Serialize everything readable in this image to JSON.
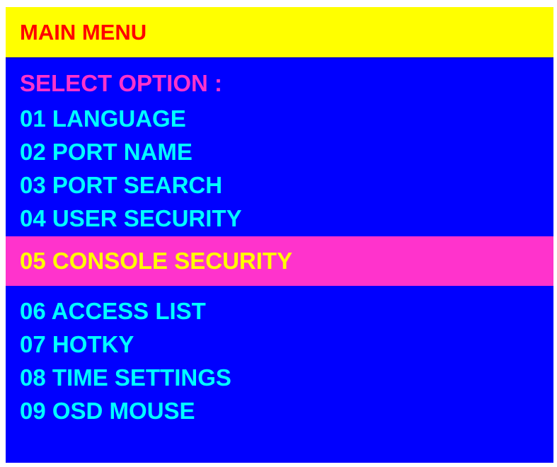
{
  "header": {
    "title": "MAIN MENU"
  },
  "prompt": "SELECT OPTION :",
  "menu": {
    "items": [
      {
        "label": "01 LANGUAGE"
      },
      {
        "label": "02 PORT NAME"
      },
      {
        "label": "03 PORT SEARCH"
      },
      {
        "label": "04 USER SECURITY"
      },
      {
        "label": "05 CONSOLE SECURITY",
        "selected": true
      },
      {
        "label": "06 ACCESS LIST"
      },
      {
        "label": "07 HOTKY"
      },
      {
        "label": "08 TIME SETTINGS"
      },
      {
        "label": "09 OSD MOUSE"
      }
    ]
  },
  "colors": {
    "header_bg": "#ffff00",
    "header_text": "#ff0000",
    "menu_bg": "#0000ff",
    "item_text": "#00ffff",
    "prompt_text": "#ff33cc",
    "selected_bg": "#ff33cc",
    "selected_text": "#ffff00"
  }
}
